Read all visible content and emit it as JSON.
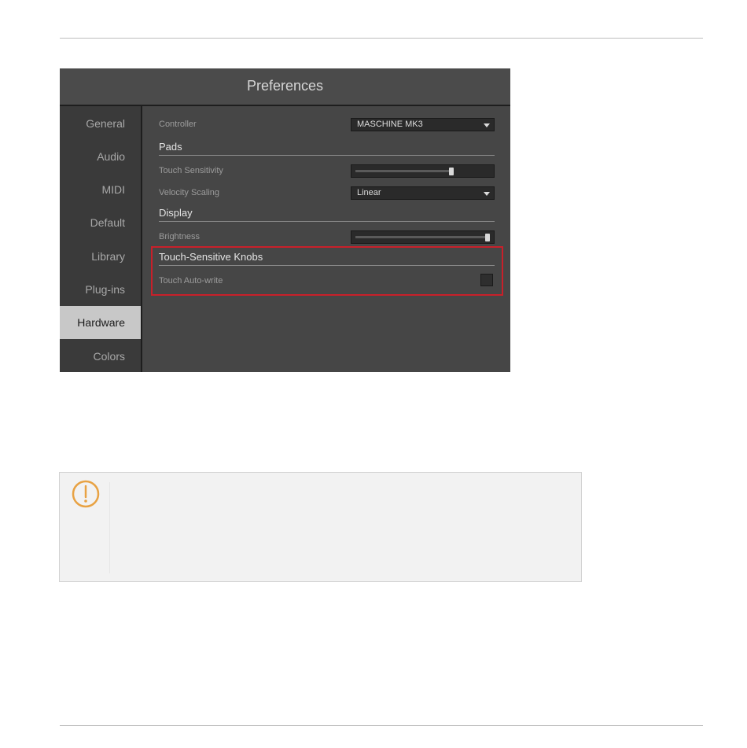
{
  "window": {
    "title": "Preferences"
  },
  "sidebar": {
    "items": [
      {
        "label": "General"
      },
      {
        "label": "Audio"
      },
      {
        "label": "MIDI"
      },
      {
        "label": "Default"
      },
      {
        "label": "Library"
      },
      {
        "label": "Plug-ins"
      },
      {
        "label": "Hardware",
        "active": true
      },
      {
        "label": "Colors"
      }
    ]
  },
  "hardware": {
    "controller": {
      "label": "Controller",
      "value": "MASCHINE MK3"
    },
    "pads": {
      "title": "Pads",
      "touch_sensitivity": {
        "label": "Touch Sensitivity",
        "value_fraction": 0.72
      },
      "velocity_scaling": {
        "label": "Velocity Scaling",
        "value": "Linear"
      }
    },
    "display": {
      "title": "Display",
      "brightness": {
        "label": "Brightness",
        "value_fraction": 1.0
      }
    },
    "touch_knobs": {
      "title": "Touch-Sensitive Knobs",
      "auto_write": {
        "label": "Touch Auto-write",
        "checked": false
      }
    }
  },
  "colors": {
    "highlight": "#c8202a",
    "note_icon": "#e8a243"
  },
  "note": {
    "icon": "warning-icon"
  }
}
